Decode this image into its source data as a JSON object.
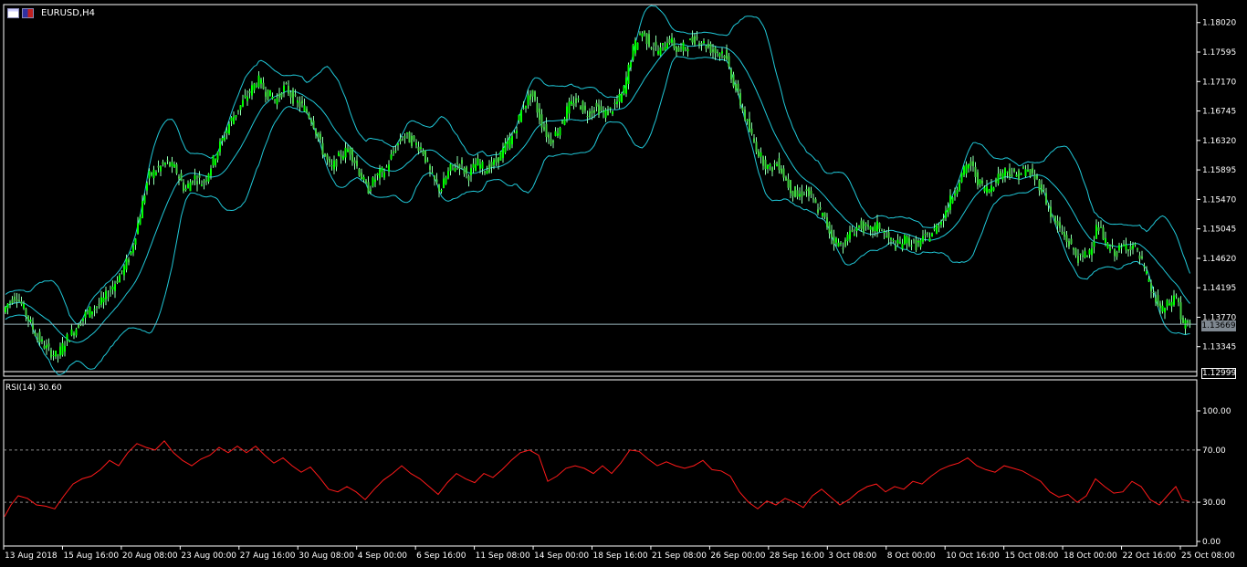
{
  "window": {
    "title": "EURUSD,H4"
  },
  "colors": {
    "background": "#000000",
    "frame": "#ffffff",
    "candle": "#00ff00",
    "candle_shadow": "#90ffb0",
    "bands": "#20c8d8",
    "rsi_line": "#ff1a1a",
    "level_line": "#8a8a8a",
    "bid_line": "#9cb8c0",
    "price_tag": "#7f8891"
  },
  "chart_data": [
    {
      "type": "candlestick",
      "symbol": "EURUSD",
      "timeframe": "H4",
      "title": "EURUSD,H4",
      "indicator": "Bollinger Bands",
      "ylim": [
        1.1292,
        1.1828
      ],
      "y_ticks": [
        "1.18020",
        "1.17595",
        "1.17170",
        "1.16745",
        "1.16320",
        "1.15895",
        "1.15470",
        "1.15045",
        "1.14620",
        "1.14195",
        "1.13770",
        "1.13345"
      ],
      "current_price_label": "1.13669",
      "current_price": 1.13669,
      "low_marker_label": "1.12999",
      "x_ticks": [
        "13 Aug 2018",
        "15 Aug 16:00",
        "20 Aug 08:00",
        "23 Aug 00:00",
        "27 Aug 16:00",
        "30 Aug 08:00",
        "4 Sep 00:00",
        "6 Sep 16:00",
        "11 Sep 08:00",
        "14 Sep 00:00",
        "18 Sep 16:00",
        "21 Sep 08:00",
        "26 Sep 00:00",
        "28 Sep 16:00",
        "3 Oct 08:00",
        "8 Oct 00:00",
        "10 Oct 16:00",
        "15 Oct 08:00",
        "18 Oct 00:00",
        "22 Oct 16:00",
        "25 Oct 08:00"
      ],
      "close_profile": [
        [
          0,
          1.1368
        ],
        [
          10,
          1.1395
        ],
        [
          20,
          1.141
        ],
        [
          28,
          1.139
        ],
        [
          38,
          1.1362
        ],
        [
          45,
          1.1345
        ],
        [
          55,
          1.133
        ],
        [
          65,
          1.132
        ],
        [
          75,
          1.1345
        ],
        [
          85,
          1.136
        ],
        [
          95,
          1.138
        ],
        [
          105,
          1.139
        ],
        [
          115,
          1.14
        ],
        [
          125,
          1.142
        ],
        [
          135,
          1.144
        ],
        [
          145,
          1.1465
        ],
        [
          155,
          1.152
        ],
        [
          165,
          1.158
        ],
        [
          175,
          1.159
        ],
        [
          185,
          1.16
        ],
        [
          195,
          1.159
        ],
        [
          205,
          1.156
        ],
        [
          215,
          1.158
        ],
        [
          225,
          1.157
        ],
        [
          235,
          1.16
        ],
        [
          245,
          1.163
        ],
        [
          255,
          1.166
        ],
        [
          265,
          1.168
        ],
        [
          275,
          1.17
        ],
        [
          285,
          1.172
        ],
        [
          295,
          1.17
        ],
        [
          305,
          1.169
        ],
        [
          315,
          1.171
        ],
        [
          325,
          1.169
        ],
        [
          335,
          1.168
        ],
        [
          345,
          1.166
        ],
        [
          355,
          1.162
        ],
        [
          365,
          1.159
        ],
        [
          375,
          1.161
        ],
        [
          385,
          1.162
        ],
        [
          395,
          1.159
        ],
        [
          405,
          1.156
        ],
        [
          415,
          1.158
        ],
        [
          425,
          1.159
        ],
        [
          435,
          1.162
        ],
        [
          445,
          1.164
        ],
        [
          455,
          1.163
        ],
        [
          465,
          1.162
        ],
        [
          475,
          1.158
        ],
        [
          485,
          1.156
        ],
        [
          495,
          1.159
        ],
        [
          505,
          1.16
        ],
        [
          515,
          1.158
        ],
        [
          525,
          1.16
        ],
        [
          535,
          1.159
        ],
        [
          545,
          1.16
        ],
        [
          555,
          1.162
        ],
        [
          565,
          1.164
        ],
        [
          575,
          1.168
        ],
        [
          585,
          1.17
        ],
        [
          595,
          1.166
        ],
        [
          605,
          1.163
        ],
        [
          615,
          1.165
        ],
        [
          625,
          1.168
        ],
        [
          635,
          1.169
        ],
        [
          645,
          1.167
        ],
        [
          655,
          1.168
        ],
        [
          665,
          1.167
        ],
        [
          675,
          1.168
        ],
        [
          685,
          1.17
        ],
        [
          695,
          1.176
        ],
        [
          705,
          1.179
        ],
        [
          715,
          1.177
        ],
        [
          725,
          1.176
        ],
        [
          735,
          1.178
        ],
        [
          745,
          1.176
        ],
        [
          755,
          1.177
        ],
        [
          765,
          1.178
        ],
        [
          775,
          1.177
        ],
        [
          785,
          1.176
        ],
        [
          795,
          1.176
        ],
        [
          805,
          1.172
        ],
        [
          815,
          1.168
        ],
        [
          825,
          1.164
        ],
        [
          835,
          1.161
        ],
        [
          845,
          1.159
        ],
        [
          855,
          1.16
        ],
        [
          865,
          1.157
        ],
        [
          875,
          1.155
        ],
        [
          885,
          1.156
        ],
        [
          895,
          1.154
        ],
        [
          905,
          1.152
        ],
        [
          915,
          1.149
        ],
        [
          925,
          1.148
        ],
        [
          935,
          1.15
        ],
        [
          945,
          1.151
        ],
        [
          955,
          1.15
        ],
        [
          965,
          1.151
        ],
        [
          975,
          1.149
        ],
        [
          985,
          1.148
        ],
        [
          995,
          1.149
        ],
        [
          1005,
          1.148
        ],
        [
          1015,
          1.149
        ],
        [
          1025,
          1.15
        ],
        [
          1035,
          1.152
        ],
        [
          1045,
          1.155
        ],
        [
          1055,
          1.158
        ],
        [
          1065,
          1.16
        ],
        [
          1075,
          1.157
        ],
        [
          1085,
          1.156
        ],
        [
          1095,
          1.158
        ],
        [
          1105,
          1.159
        ],
        [
          1115,
          1.158
        ],
        [
          1125,
          1.159
        ],
        [
          1135,
          1.158
        ],
        [
          1145,
          1.156
        ],
        [
          1155,
          1.152
        ],
        [
          1165,
          1.15
        ],
        [
          1175,
          1.148
        ],
        [
          1185,
          1.146
        ],
        [
          1195,
          1.147
        ],
        [
          1205,
          1.151
        ],
        [
          1215,
          1.148
        ],
        [
          1225,
          1.147
        ],
        [
          1235,
          1.148
        ],
        [
          1245,
          1.148
        ],
        [
          1255,
          1.145
        ],
        [
          1265,
          1.141
        ],
        [
          1275,
          1.1385
        ],
        [
          1285,
          1.14
        ],
        [
          1292,
          1.141
        ],
        [
          1297,
          1.1367
        ],
        [
          1305,
          1.1366
        ]
      ]
    },
    {
      "type": "line",
      "indicator": "RSI",
      "label": "RSI(14) 30.60",
      "period": 14,
      "current_value": 30.6,
      "ylim": [
        0,
        100
      ],
      "y_ticks": [
        "100.00",
        "70.00",
        "30.00",
        "0.00"
      ],
      "levels": [
        70,
        30
      ],
      "points": [
        [
          5,
          19
        ],
        [
          12,
          28
        ],
        [
          20,
          35
        ],
        [
          30,
          33
        ],
        [
          40,
          28
        ],
        [
          50,
          27
        ],
        [
          60,
          25
        ],
        [
          70,
          35
        ],
        [
          80,
          44
        ],
        [
          90,
          48
        ],
        [
          100,
          50
        ],
        [
          110,
          55
        ],
        [
          120,
          62
        ],
        [
          130,
          58
        ],
        [
          140,
          68
        ],
        [
          150,
          75
        ],
        [
          160,
          72
        ],
        [
          170,
          70
        ],
        [
          180,
          77
        ],
        [
          190,
          68
        ],
        [
          200,
          62
        ],
        [
          210,
          58
        ],
        [
          220,
          63
        ],
        [
          230,
          66
        ],
        [
          240,
          72
        ],
        [
          250,
          68
        ],
        [
          260,
          73
        ],
        [
          270,
          68
        ],
        [
          280,
          73
        ],
        [
          290,
          66
        ],
        [
          300,
          60
        ],
        [
          310,
          64
        ],
        [
          320,
          58
        ],
        [
          330,
          53
        ],
        [
          340,
          57
        ],
        [
          350,
          49
        ],
        [
          360,
          40
        ],
        [
          370,
          38
        ],
        [
          380,
          42
        ],
        [
          390,
          38
        ],
        [
          400,
          32
        ],
        [
          410,
          40
        ],
        [
          420,
          47
        ],
        [
          430,
          52
        ],
        [
          440,
          58
        ],
        [
          450,
          52
        ],
        [
          460,
          48
        ],
        [
          470,
          42
        ],
        [
          480,
          36
        ],
        [
          490,
          45
        ],
        [
          500,
          52
        ],
        [
          510,
          48
        ],
        [
          520,
          45
        ],
        [
          530,
          52
        ],
        [
          540,
          49
        ],
        [
          550,
          55
        ],
        [
          560,
          62
        ],
        [
          570,
          68
        ],
        [
          580,
          70
        ],
        [
          590,
          66
        ],
        [
          600,
          46
        ],
        [
          610,
          50
        ],
        [
          620,
          56
        ],
        [
          630,
          58
        ],
        [
          640,
          56
        ],
        [
          650,
          52
        ],
        [
          660,
          58
        ],
        [
          670,
          52
        ],
        [
          680,
          60
        ],
        [
          690,
          70
        ],
        [
          700,
          69
        ],
        [
          710,
          63
        ],
        [
          720,
          58
        ],
        [
          730,
          61
        ],
        [
          740,
          58
        ],
        [
          750,
          56
        ],
        [
          760,
          58
        ],
        [
          770,
          62
        ],
        [
          780,
          55
        ],
        [
          790,
          54
        ],
        [
          800,
          50
        ],
        [
          810,
          38
        ],
        [
          820,
          30
        ],
        [
          830,
          25
        ],
        [
          840,
          31
        ],
        [
          850,
          28
        ],
        [
          860,
          33
        ],
        [
          870,
          30
        ],
        [
          880,
          26
        ],
        [
          890,
          35
        ],
        [
          900,
          40
        ],
        [
          910,
          34
        ],
        [
          920,
          28
        ],
        [
          930,
          32
        ],
        [
          940,
          38
        ],
        [
          950,
          42
        ],
        [
          960,
          44
        ],
        [
          970,
          38
        ],
        [
          980,
          42
        ],
        [
          990,
          40
        ],
        [
          1000,
          46
        ],
        [
          1010,
          44
        ],
        [
          1020,
          50
        ],
        [
          1030,
          55
        ],
        [
          1040,
          58
        ],
        [
          1050,
          60
        ],
        [
          1060,
          64
        ],
        [
          1070,
          58
        ],
        [
          1080,
          55
        ],
        [
          1090,
          53
        ],
        [
          1100,
          58
        ],
        [
          1110,
          56
        ],
        [
          1120,
          54
        ],
        [
          1130,
          50
        ],
        [
          1140,
          46
        ],
        [
          1150,
          38
        ],
        [
          1160,
          34
        ],
        [
          1170,
          36
        ],
        [
          1180,
          30
        ],
        [
          1190,
          35
        ],
        [
          1200,
          48
        ],
        [
          1210,
          42
        ],
        [
          1220,
          37
        ],
        [
          1230,
          38
        ],
        [
          1240,
          46
        ],
        [
          1250,
          42
        ],
        [
          1260,
          32
        ],
        [
          1270,
          28
        ],
        [
          1280,
          36
        ],
        [
          1288,
          42
        ],
        [
          1295,
          32
        ],
        [
          1303,
          30.6
        ]
      ]
    }
  ]
}
